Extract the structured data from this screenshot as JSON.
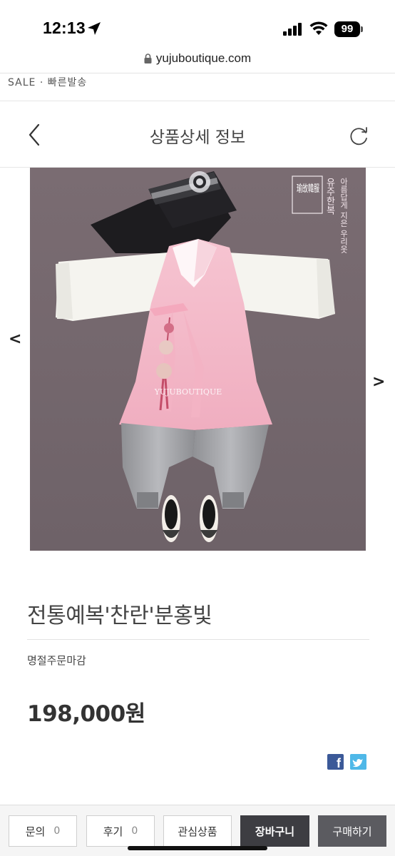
{
  "status_bar": {
    "time": "12:13",
    "battery": "99"
  },
  "browser": {
    "url": "yujuboutique.com"
  },
  "breadcrumb": {
    "text": "SALE · 빠른발송"
  },
  "header": {
    "title": "상품상세 정보",
    "back_icon": "chevron-left-icon",
    "refresh_icon": "refresh-icon"
  },
  "gallery": {
    "prev_label": "<",
    "next_label": ">",
    "image_watermark": "YUJUBOUTIQUE",
    "logo_text": "瑜敀韓服",
    "vertical_brand": "유주한복",
    "vertical_slogan": "아름답게 지은 우리옷"
  },
  "product": {
    "name": "전통예복'찬란'분홍빛",
    "note": "명절주문마감",
    "price": "198,000원"
  },
  "share": {
    "facebook_label": "f",
    "facebook_color": "#3b5998",
    "twitter_color": "#4fb8e8"
  },
  "toolbar": {
    "qna_label": "문의",
    "qna_count": "0",
    "review_label": "후기",
    "review_count": "0",
    "wishlist_label": "관심상품",
    "cart_label": "장바구니",
    "buy_label": "구매하기"
  },
  "colors": {
    "background_photo": "#786b70",
    "vest_pink": "#f3b8c8",
    "cart_button": "#3d3d42",
    "buy_button": "#5b5b60"
  }
}
